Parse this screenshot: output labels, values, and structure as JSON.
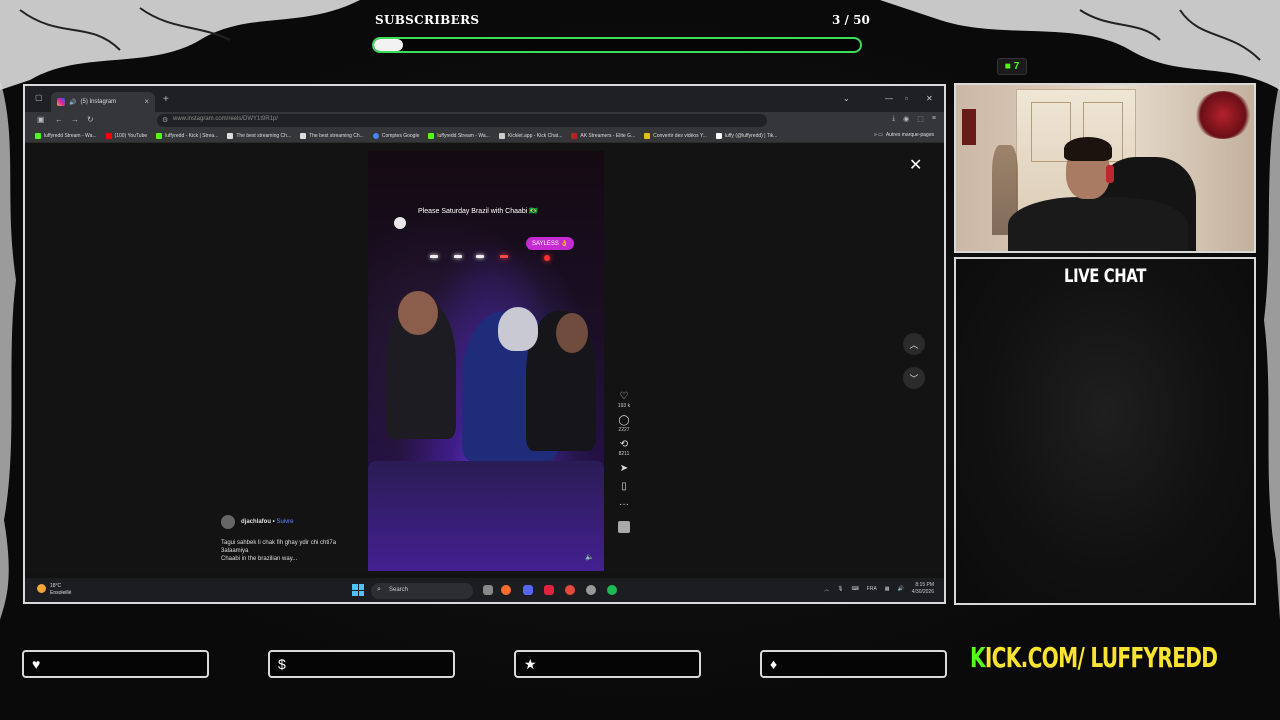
{
  "stream_overlay": {
    "goal": {
      "label": "SUBSCRIBERS",
      "count_text": "3 / 50",
      "progress_fraction": 0.06
    },
    "kick_badge": {
      "text": "7"
    },
    "chat_title": "LIVE CHAT",
    "kick_url": {
      "k": "K",
      "rest": "ICK.COM/ LUFFYREDD"
    },
    "bottom_buttons": [
      {
        "icon": "heart-icon",
        "glyph": "♥"
      },
      {
        "icon": "dollar-icon",
        "glyph": "$"
      },
      {
        "icon": "star-icon",
        "glyph": "★"
      },
      {
        "icon": "diamond-icon",
        "glyph": "♦"
      }
    ],
    "accent_colors": {
      "kick_green": "#53fc18",
      "goal_bar": "#3ddc5a",
      "kick_yellow": "#f8e232"
    }
  },
  "browser": {
    "tab_title": "(5) Instagram",
    "tab_close": "×",
    "new_tab": "+",
    "url": "www.instagram.com/reels/DWY1t9R1p/",
    "bookmarks": [
      "luffyredd Stream - Wa...",
      "(100) YouTube",
      "luffyredd - Kick | Strea...",
      "The best streaming Ch...",
      "The best streaming Ch...",
      "Comptes Google",
      "luffyredd Stream - Wa...",
      "Kicklet.app - Kick Chat...",
      "AK Streamers - Elite G...",
      "Convertir des vidéos Y...",
      "luffy (@luffyredd) | Tik..."
    ],
    "bookmarks_other": "Autres marque-pages"
  },
  "instagram": {
    "reel_comment": "Please Saturday Brazil with Chaabi 🇧🇷",
    "reel_pill": "SAYLESS 👌",
    "actions": [
      {
        "icon": "heart-icon",
        "glyph": "♡",
        "count": "193 k"
      },
      {
        "icon": "comment-icon",
        "glyph": "◯",
        "count": "2227"
      },
      {
        "icon": "repost-icon",
        "glyph": "⟲",
        "count": "8211"
      },
      {
        "icon": "share-icon",
        "glyph": "➤",
        "count": ""
      },
      {
        "icon": "bookmark-icon",
        "glyph": "▯",
        "count": ""
      },
      {
        "icon": "more-icon",
        "glyph": "···",
        "count": ""
      }
    ],
    "poster_name": "djachlafou",
    "poster_sep": " • ",
    "follow_label": "Suivre",
    "caption_lines": [
      "Tagui sahbek li chak fih ghay ydir chi chti7a",
      "3alaamiya",
      "Chaabi in the brazilian way..."
    ]
  },
  "taskbar": {
    "weather_temp": "18°C",
    "weather_desc": "Ensoleillé",
    "search_placeholder": "Search",
    "language": "FRA",
    "time": "8:15 PM",
    "date": "4/30/2026"
  }
}
